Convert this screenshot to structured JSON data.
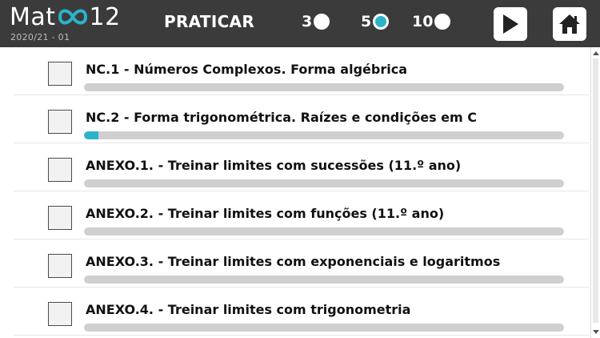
{
  "header": {
    "logo_left": "Mat",
    "logo_right": "12",
    "logo_symbol": "infinity-icon",
    "subtitle": "2020/21 - 01",
    "title": "PRATICAR",
    "options": [
      {
        "label": "3",
        "selected": false
      },
      {
        "label": "5",
        "selected": true
      },
      {
        "label": "10",
        "selected": false
      }
    ],
    "play_icon": "play-icon",
    "home_icon": "home-icon"
  },
  "colors": {
    "header_bg": "#3b3b3b",
    "accent": "#2bb3c9",
    "bar_bg": "#cfcfcf"
  },
  "topics": [
    {
      "title": "NC.1 - Números Complexos. Forma algébrica",
      "progress": 0
    },
    {
      "title": "NC.2 - Forma trigonométrica. Raízes e condições em C",
      "progress": 0.03
    },
    {
      "title": "ANEXO.1. - Treinar limites com sucessões (11.º ano)",
      "progress": 0
    },
    {
      "title": "ANEXO.2. - Treinar limites com funções (11.º ano)",
      "progress": 0
    },
    {
      "title": "ANEXO.3. - Treinar limites com exponenciais e logaritmos",
      "progress": 0
    },
    {
      "title": "ANEXO.4. - Treinar limites com trigonometria",
      "progress": 0
    }
  ]
}
